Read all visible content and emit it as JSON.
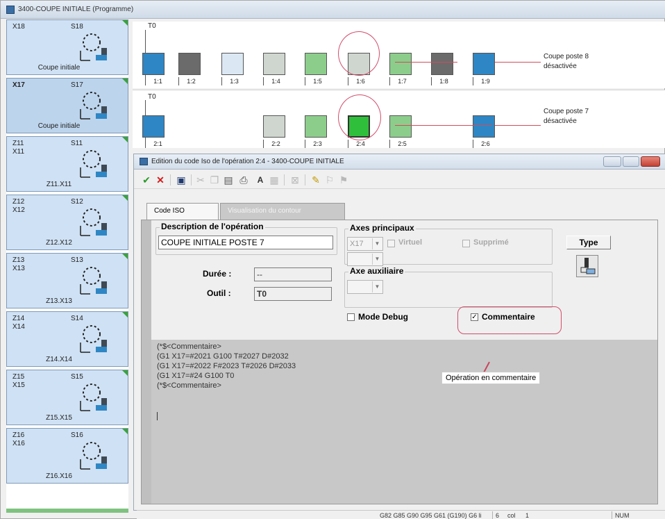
{
  "window_title": "3400-COUPE INITIALE (Programme)",
  "axes": [
    {
      "axis": "X18",
      "axis2": "",
      "spindle": "S18",
      "caption": "Coupe initiale"
    },
    {
      "axis": "X17",
      "axis2": "",
      "spindle": "S17",
      "caption": "Coupe initiale"
    },
    {
      "axis": "Z11",
      "axis2": "X11",
      "spindle": "S11",
      "caption": "Z11.X11"
    },
    {
      "axis": "Z12",
      "axis2": "X12",
      "spindle": "S12",
      "caption": "Z12.X12"
    },
    {
      "axis": "Z13",
      "axis2": "X13",
      "spindle": "S13",
      "caption": "Z13.X13"
    },
    {
      "axis": "Z14",
      "axis2": "X14",
      "spindle": "S14",
      "caption": "Z14.X14"
    },
    {
      "axis": "Z15",
      "axis2": "X15",
      "spindle": "S15",
      "caption": "Z15.X15"
    },
    {
      "axis": "Z16",
      "axis2": "X16",
      "spindle": "S16",
      "caption": "Z16.X16"
    }
  ],
  "timeline": {
    "lane1": {
      "t0": "T0",
      "ops": [
        "1:1",
        "1:2",
        "1:3",
        "1:4",
        "1:5",
        "1:6",
        "1:7",
        "1:8",
        "1:9"
      ],
      "note_line1": "Coupe poste 8",
      "note_line2": "désactivée"
    },
    "lane2": {
      "t0": "T0",
      "ops": [
        "2:1",
        "2:2",
        "2:3",
        "2:4",
        "2:5",
        "2:6"
      ],
      "note_line1": "Coupe poste 7",
      "note_line2": "désactivée"
    }
  },
  "dialog": {
    "title": "Edition du code Iso de l'opération 2:4 - 3400-COUPE INITIALE",
    "tabs": {
      "iso": "Code ISO",
      "visual": "Visualisation du contour"
    },
    "description_legend": "Description de l'opération",
    "description_value": "COUPE INITIALE POSTE 7",
    "duree_label": "Durée :",
    "duree_value": "--",
    "outil_label": "Outil :",
    "outil_value": "T0",
    "axes_legend": "Axes principaux",
    "axes_value": "X17",
    "virtuel_label": "Virtuel",
    "supprime_label": "Supprimé",
    "aux_legend": "Axe auxiliaire",
    "debug_label": "Mode Debug",
    "comment_label": "Commentaire",
    "type_label": "Type",
    "code_lines": [
      "(*$<Commentaire>",
      "(G1 X17=#2021 G100 T#2027 D#2032",
      "(G1 X17=#2022 F#2023 T#2026 D#2033",
      "(G1 X17=#24 G100 T0",
      "(*$<Commentaire>"
    ],
    "callout": "Opération en commentaire"
  },
  "status": {
    "gcodes": "G82 G85 G90 G95 G61 (G190) G6 li",
    "line": "6",
    "col_label": "col",
    "col": "1",
    "num": "NUM"
  },
  "colors": {
    "op_green": "#8ccd8c",
    "op_active": "#2fbf3a",
    "axis_card": "#cfe1f4",
    "highlight_ring": "#d24d6a"
  }
}
